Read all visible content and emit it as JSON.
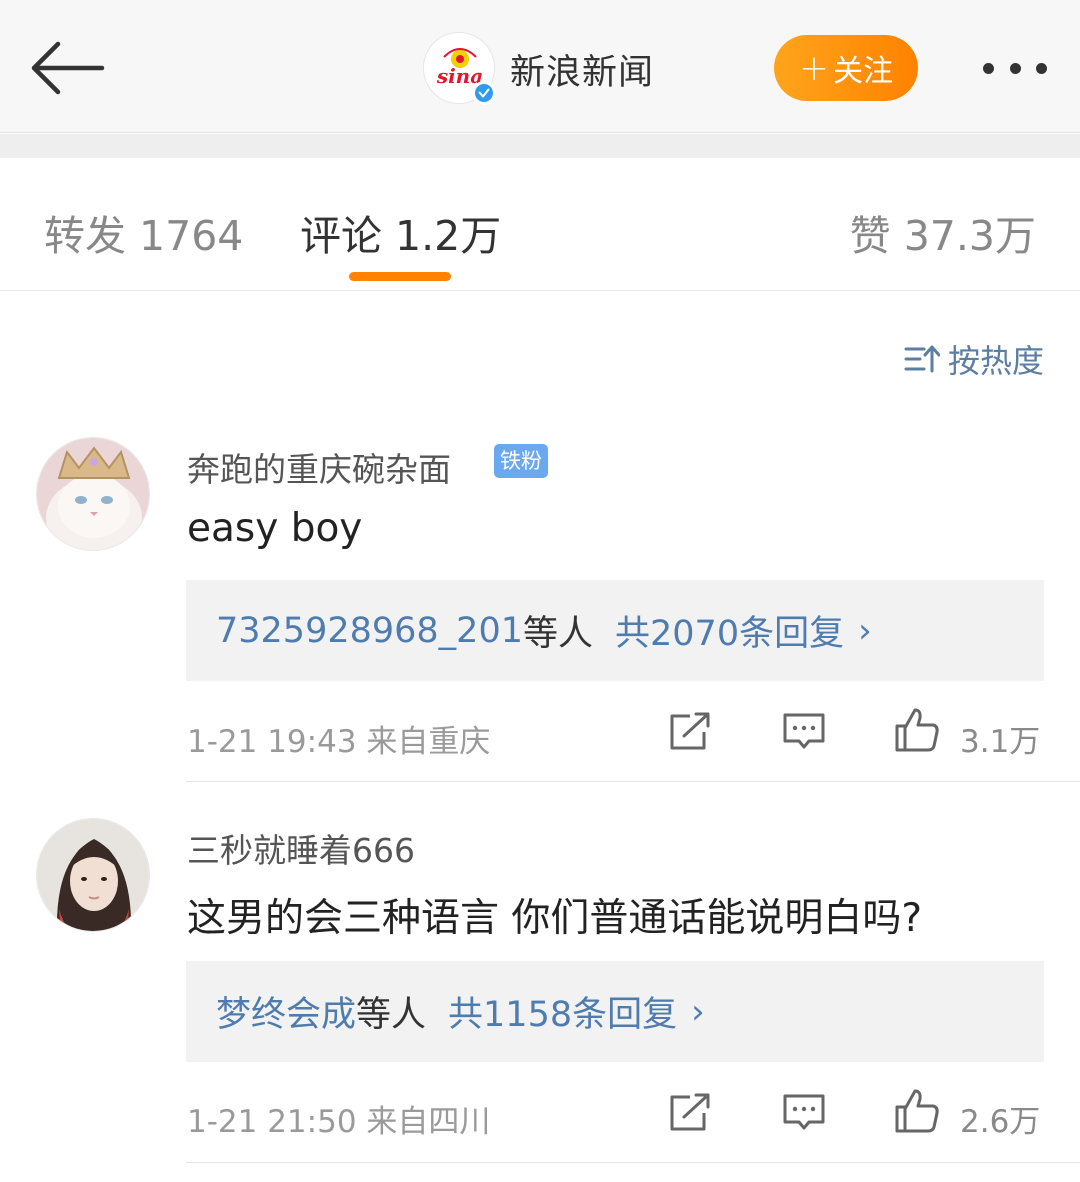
{
  "header": {
    "back_icon": "back-arrow-icon",
    "account_name": "新浪新闻",
    "logo_text": "sina",
    "verified_icon": "verified-badge-icon",
    "follow_label": "关注",
    "follow_plus": "+",
    "more_icon": "more-dots-icon",
    "colors": {
      "follow_start": "#ffa41c",
      "follow_end": "#ff8200",
      "background": "#f7f7f7"
    }
  },
  "tabs": [
    {
      "label": "转发 1764",
      "active": false
    },
    {
      "label": "评论 1.2万",
      "active": true
    },
    {
      "label": "赞 37.3万",
      "active": false
    }
  ],
  "tab_indicator_color": "#ff8200",
  "sort": {
    "label": "按热度",
    "icon": "sort-icon"
  },
  "comments": [
    {
      "username": "奔跑的重庆碗杂面",
      "badge": "铁粉",
      "text": "easy boy",
      "avatar_icon": "cat-with-crown-avatar",
      "replies": {
        "user": "7325928968_201",
        "suffix": "等人",
        "total": "共2070条回复",
        "chevron": "›"
      },
      "meta": "1-21 19:43  来自重庆",
      "likes": "3.1万"
    },
    {
      "username": "三秒就睡着666",
      "badge": "",
      "text": "这男的会三种语言 你们普通话能说明白吗?",
      "avatar_icon": "girl-portrait-avatar",
      "replies": {
        "user": "梦终会成",
        "suffix": "等人",
        "total": "共1158条回复",
        "chevron": "›"
      },
      "meta": "1-21 21:50  来自四川",
      "likes": "2.6万"
    }
  ],
  "action_icons": {
    "repost": "repost-icon",
    "comment": "comment-icon",
    "like": "thumbs-up-icon"
  },
  "link_color": "#4f7cae"
}
